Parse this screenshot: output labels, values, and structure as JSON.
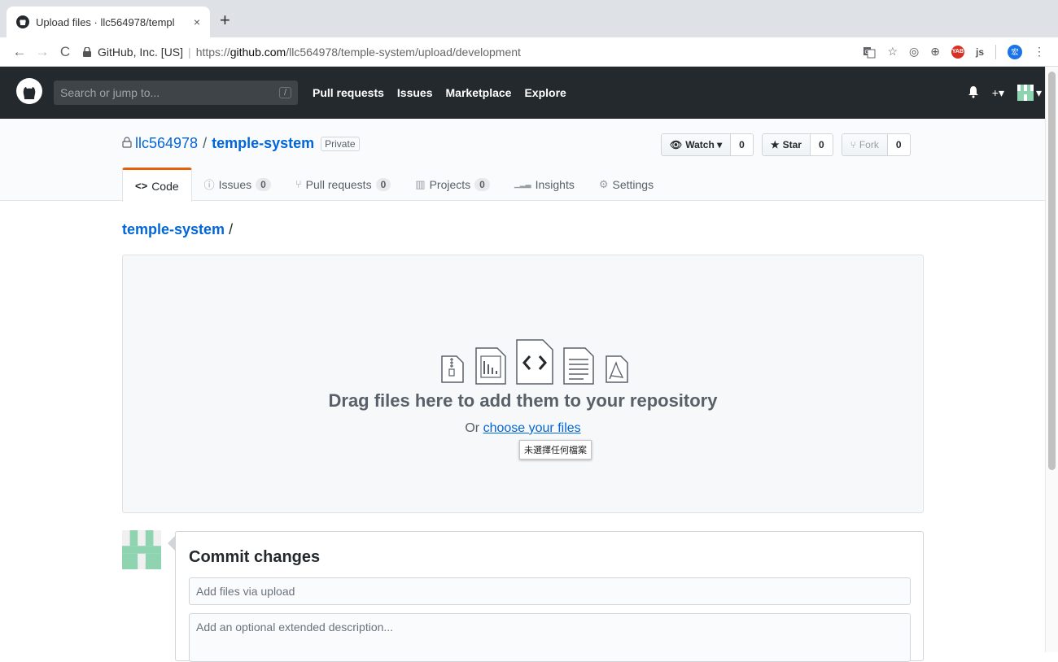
{
  "browser": {
    "tab_title": "Upload files · llc564978/templ",
    "tab_close": "×",
    "new_tab": "+",
    "back": "←",
    "forward": "→",
    "reload": "C",
    "site_identity": "GitHub, Inc. [US]",
    "url_prefix": "https://",
    "url_host": "github.com",
    "url_path": "/llc564978/temple-system/upload/development",
    "ext_yab": "YAB",
    "ext_js": "js",
    "ext_user": "宏",
    "menu": "⋮"
  },
  "github": {
    "search_placeholder": "Search or jump to...",
    "search_key": "/",
    "nav": [
      "Pull requests",
      "Issues",
      "Marketplace",
      "Explore"
    ],
    "bell": "🔔",
    "plus": "+▾",
    "avatar_caret": "▾"
  },
  "repo": {
    "owner": "llc564978",
    "name": "temple-system",
    "visibility": "Private",
    "watch_label": "Watch ▾",
    "watch_count": "0",
    "star_label": "Star",
    "star_count": "0",
    "fork_label": "Fork",
    "fork_count": "0",
    "tabs": [
      {
        "label": "Code",
        "icon": "<>",
        "count": null
      },
      {
        "label": "Issues",
        "icon": "ⓘ",
        "count": "0"
      },
      {
        "label": "Pull requests",
        "icon": "⑂",
        "count": "0"
      },
      {
        "label": "Projects",
        "icon": "▥",
        "count": "0"
      },
      {
        "label": "Insights",
        "icon": "▁▂▃",
        "count": null
      },
      {
        "label": "Settings",
        "icon": "⚙",
        "count": null
      }
    ]
  },
  "upload": {
    "breadcrumb_repo": "temple-system",
    "breadcrumb_sep": "/",
    "drop_title": "Drag files here to add them to your repository",
    "drop_or": "Or ",
    "choose_link": "choose your files",
    "file_input_tooltip": "未選擇任何檔案"
  },
  "commit": {
    "title": "Commit changes",
    "summary_placeholder": "Add files via upload",
    "description_placeholder": "Add an optional extended description..."
  }
}
